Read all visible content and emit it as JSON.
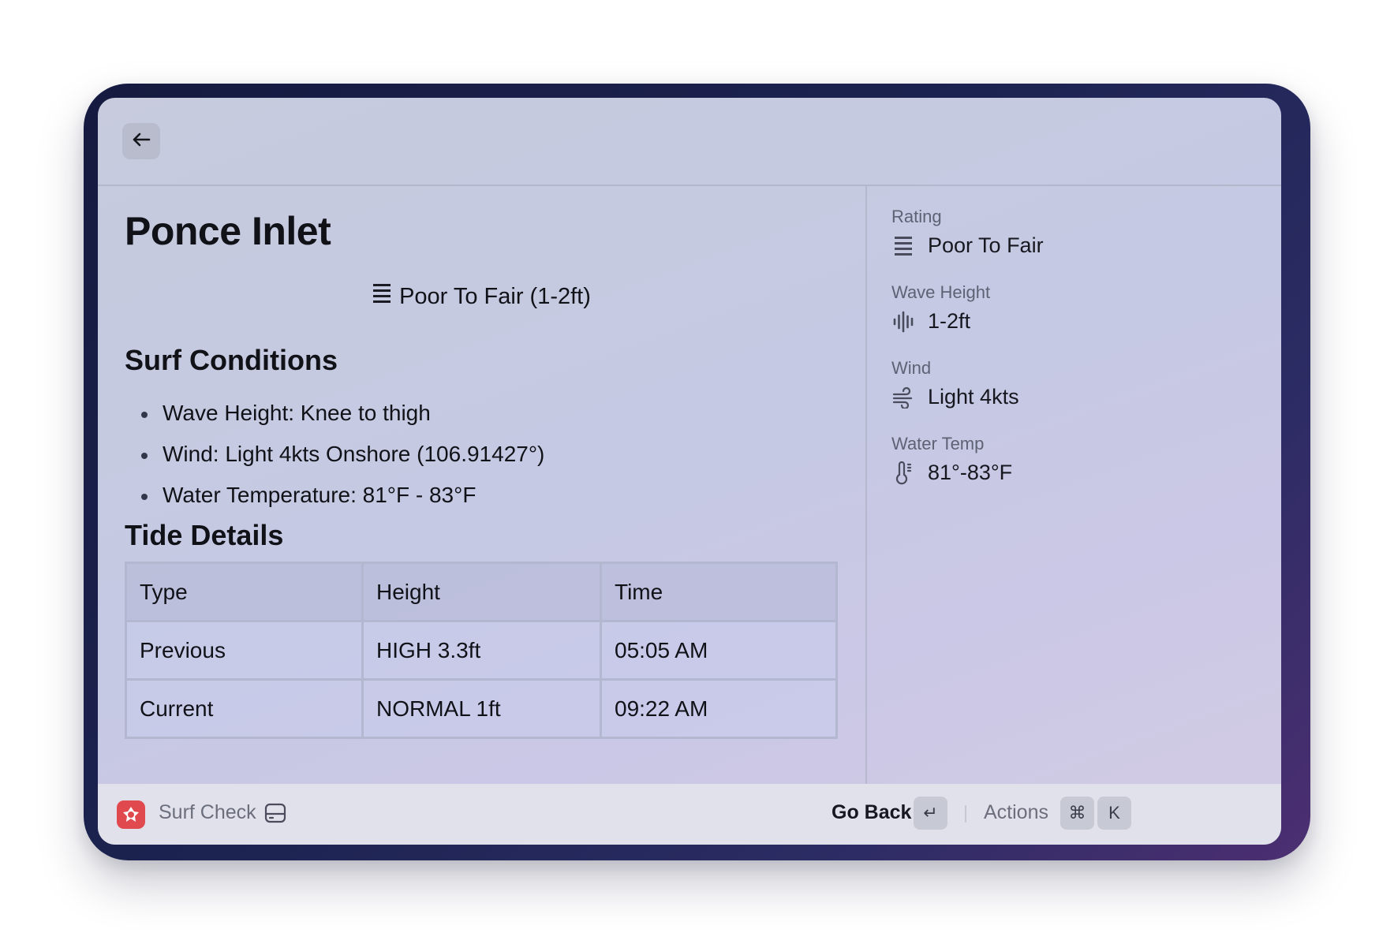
{
  "window": {
    "back_icon": "arrow-left-icon"
  },
  "detail": {
    "title": "Ponce Inlet",
    "rating_summary": "Poor To Fair (1-2ft)",
    "rating_icon": "rating-bars-icon",
    "surf_conditions": {
      "heading": "Surf Conditions",
      "items": [
        "Wave Height: Knee to thigh",
        "Wind: Light 4kts Onshore (106.91427°)",
        "Water Temperature: 81°F - 83°F"
      ]
    },
    "tide_details": {
      "heading": "Tide Details",
      "columns": [
        "Type",
        "Height",
        "Time"
      ],
      "rows": [
        [
          "Previous",
          "HIGH 3.3ft",
          "05:05 AM"
        ],
        [
          "Current",
          "NORMAL 1ft",
          "09:22 AM"
        ]
      ]
    }
  },
  "metadata": {
    "rating": {
      "label": "Rating",
      "value": "Poor To Fair",
      "icon": "rating-bars-icon"
    },
    "wave_height": {
      "label": "Wave Height",
      "value": "1-2ft",
      "icon": "waveform-icon"
    },
    "wind": {
      "label": "Wind",
      "value": "Light 4kts",
      "icon": "wind-icon"
    },
    "water_temp": {
      "label": "Water Temp",
      "value": "81°-83°F",
      "icon": "thermometer-icon"
    }
  },
  "action_bar": {
    "app_name": "Surf Check",
    "app_icon": "surf-check-app-icon",
    "extra_icon": "drive-icon",
    "primary_action": "Go Back",
    "primary_shortcut": "↵",
    "secondary_action": "Actions",
    "secondary_shortcut_mod": "⌘",
    "secondary_shortcut_key": "K"
  },
  "colors": {
    "frame": "#1c2350",
    "window_background": "#c7cbdd",
    "action_bar_background": "#e0e1ea",
    "app_icon": "#e04a4f"
  }
}
